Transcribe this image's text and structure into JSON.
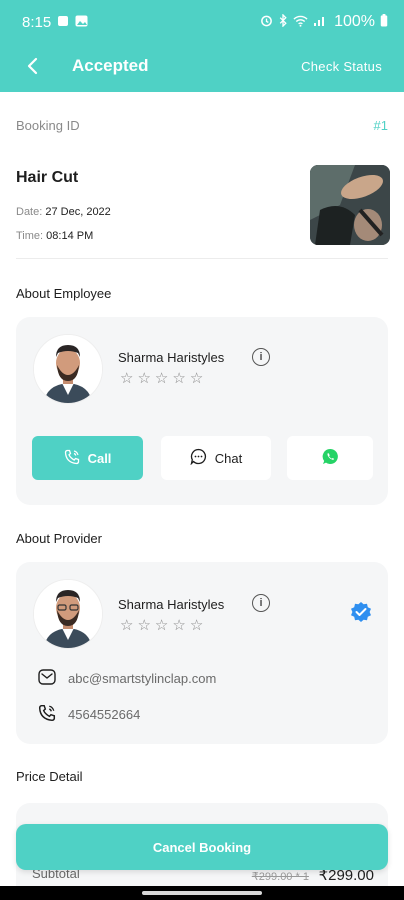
{
  "status_bar": {
    "time": "8:15",
    "battery": "100%"
  },
  "app_bar": {
    "title": "Accepted",
    "check_status": "Check Status"
  },
  "booking": {
    "id_label": "Booking ID",
    "id_value": "#1",
    "service_name": "Hair Cut",
    "date_label": "Date:",
    "date_value": "27 Dec, 2022",
    "time_label": "Time:",
    "time_value": "08:14 PM"
  },
  "employee": {
    "section_title": "About Employee",
    "name": "Sharma Haristyles",
    "rating": 0,
    "call_label": "Call",
    "chat_label": "Chat"
  },
  "provider": {
    "section_title": "About Provider",
    "name": "Sharma Haristyles",
    "rating": 0,
    "email": "abc@smartstylinclap.com",
    "phone": "4564552664",
    "verified": true
  },
  "price": {
    "section_title": "Price Detail",
    "subtotal_label": "Subtotal",
    "subtotal_original": "₹299.00 * 1",
    "subtotal_value": "₹299.00"
  },
  "actions": {
    "cancel_label": "Cancel Booking"
  },
  "colors": {
    "accent": "#4fd1c5",
    "card_bg": "#f5f6f7",
    "verified": "#2f8ff0",
    "whatsapp": "#25d366"
  }
}
